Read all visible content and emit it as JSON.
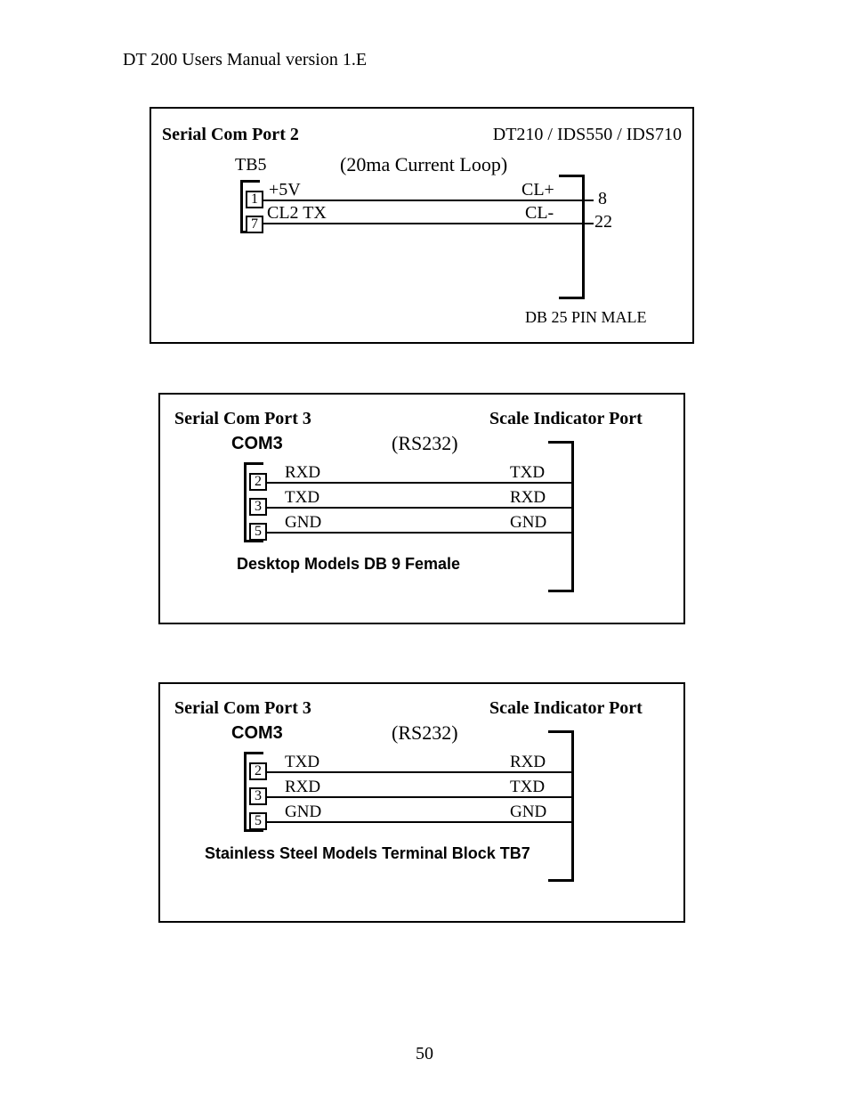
{
  "header": "DT 200 Users Manual version 1.E",
  "page_number": "50",
  "diagram1": {
    "title_left": "Serial Com Port  2",
    "title_right": "DT210 / IDS550 / IDS710",
    "tb_label": "TB5",
    "loop_label": "(20ma Current Loop)",
    "pins": {
      "p1": "1",
      "p7": "7"
    },
    "left_signals": {
      "s1": "+5V",
      "s2": "CL2 TX"
    },
    "right_signals": {
      "s1": "CL+",
      "s2": "CL-"
    },
    "right_pins": {
      "p8": "8",
      "p22": "22"
    },
    "connector_label": "DB 25 PIN MALE"
  },
  "diagram2": {
    "title_left": "Serial Com Port 3",
    "title_right": "Scale Indicator Port",
    "com_label": "COM3",
    "protocol": "(RS232)",
    "pins": {
      "p2": "2",
      "p3": "3",
      "p5": "5"
    },
    "left_signals": {
      "s1": "RXD",
      "s2": "TXD",
      "s3": "GND"
    },
    "right_signals": {
      "s1": "TXD",
      "s2": "RXD",
      "s3": "GND"
    },
    "caption": "Desktop Models DB 9 Female"
  },
  "diagram3": {
    "title_left": "Serial Com Port 3",
    "title_right": "Scale Indicator Port",
    "com_label": "COM3",
    "protocol": "(RS232)",
    "pins": {
      "p2": "2",
      "p3": "3",
      "p5": "5"
    },
    "left_signals": {
      "s1": "TXD",
      "s2": "RXD",
      "s3": "GND"
    },
    "right_signals": {
      "s1": "RXD",
      "s2": "TXD",
      "s3": "GND"
    },
    "caption": "Stainless Steel Models Terminal Block TB7"
  }
}
